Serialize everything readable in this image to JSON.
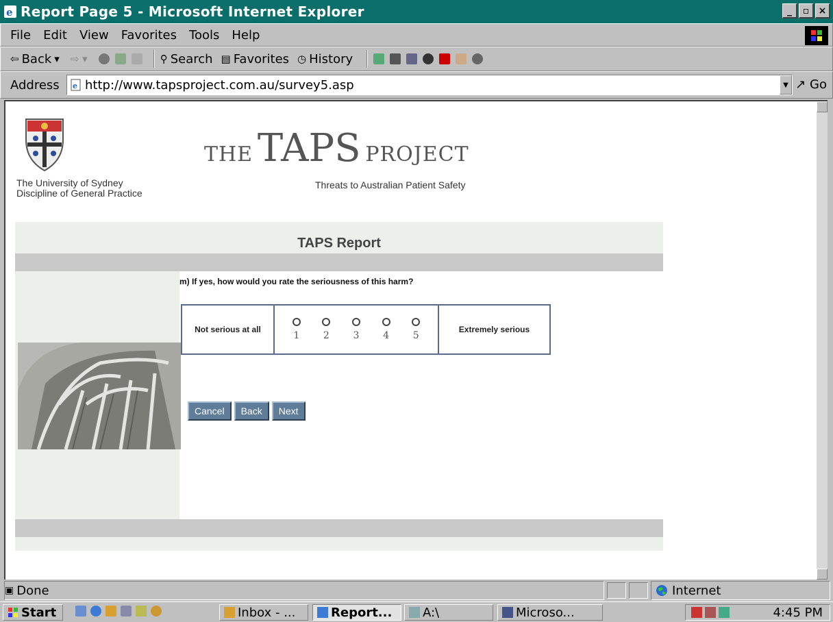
{
  "window": {
    "title": "Report Page 5 - Microsoft Internet Explorer",
    "min_label": "_",
    "max_label": "▫",
    "close_label": "×"
  },
  "menu": {
    "items": [
      "File",
      "Edit",
      "View",
      "Favorites",
      "Tools",
      "Help"
    ]
  },
  "toolbar": {
    "back": "Back",
    "search": "Search",
    "favorites": "Favorites",
    "history": "History"
  },
  "address": {
    "label": "Address",
    "url": "http://www.tapsproject.com.au/survey5.asp",
    "go": "Go"
  },
  "page": {
    "university_line1": "The University of Sydney",
    "university_line2": "Discipline of General Practice",
    "brand_the": "THE",
    "brand_taps": "TAPS",
    "brand_project": "PROJECT",
    "brand_subtitle": "Threats to Australian Patient Safety",
    "report_title": "TAPS Report",
    "question": "m) If yes, how would you rate the seriousness of this harm?",
    "scale_low": "Not serious at all",
    "scale_high": "Extremely serious",
    "options": [
      "1",
      "2",
      "3",
      "4",
      "5"
    ],
    "buttons": {
      "cancel": "Cancel",
      "back": "Back",
      "next": "Next"
    }
  },
  "status": {
    "text": "Done",
    "zone": "Internet"
  },
  "taskbar": {
    "start": "Start",
    "tasks": [
      "Inbox - ...",
      "Report...",
      "A:\\",
      "Microso..."
    ],
    "clock": "4:45 PM"
  },
  "colors": {
    "title_bar": "#0a6f6a",
    "panel_bg": "#ecefea",
    "button_bg": "#5f7c99",
    "table_border": "#5a6b8a"
  }
}
